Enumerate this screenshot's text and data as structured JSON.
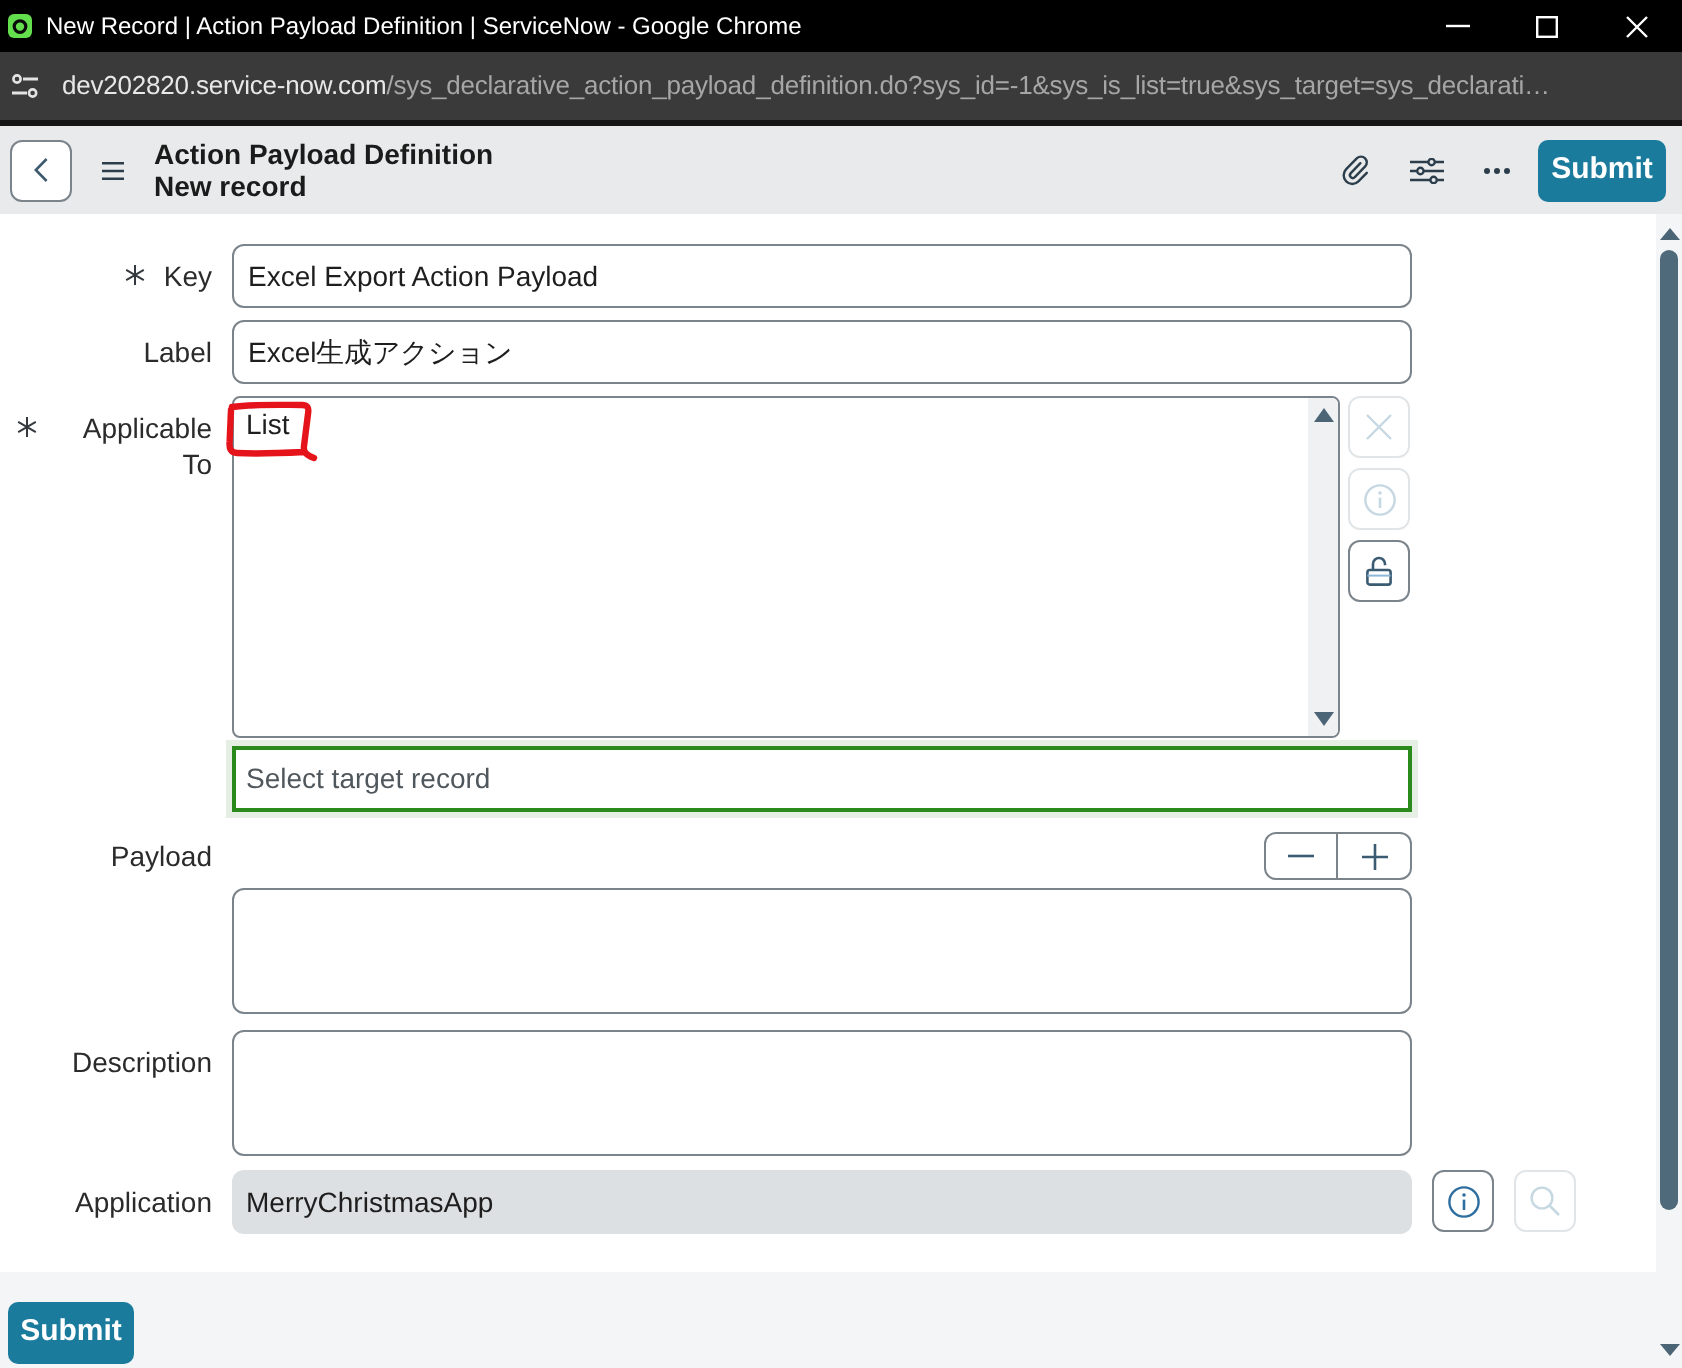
{
  "window": {
    "title": "New Record | Action Payload Definition | ServiceNow - Google Chrome"
  },
  "address_bar": {
    "host": "dev202820.service-now.com",
    "path": "/sys_declarative_action_payload_definition.do?sys_id=-1&sys_is_list=true&sys_target=sys_declarati…"
  },
  "header": {
    "title": "Action Payload Definition",
    "subtitle": "New record",
    "submit": "Submit"
  },
  "form": {
    "fields": [
      {
        "kind": "text",
        "label": "Key",
        "required": true,
        "value": "Excel Export Action Payload"
      },
      {
        "kind": "text",
        "label": "Label",
        "required": false,
        "value": "Excel生成アクション"
      },
      {
        "kind": "list",
        "label": "Applicable To",
        "required": true,
        "options": [
          {
            "label": "List",
            "highlighted": true
          }
        ],
        "buttons": [
          {
            "kind": "clear",
            "disabled": true
          },
          {
            "kind": "info",
            "disabled": true
          },
          {
            "kind": "lock",
            "disabled": false
          }
        ]
      },
      {
        "kind": "lookup",
        "placeholder": "Select target record",
        "focused": true
      },
      {
        "kind": "textarea",
        "label": "Payload",
        "required": false,
        "buttons": [
          {
            "kind": "remove",
            "disabled": false
          },
          {
            "kind": "add",
            "disabled": false
          }
        ]
      },
      {
        "kind": "textarea",
        "label": "Description",
        "required": false
      },
      {
        "kind": "reference",
        "label": "Application",
        "required": false,
        "value": "MerryChristmasApp",
        "readonly": true,
        "buttons": [
          {
            "kind": "info",
            "disabled": false
          },
          {
            "kind": "search",
            "disabled": true
          }
        ]
      }
    ]
  },
  "footer": {
    "submit": "Submit"
  }
}
